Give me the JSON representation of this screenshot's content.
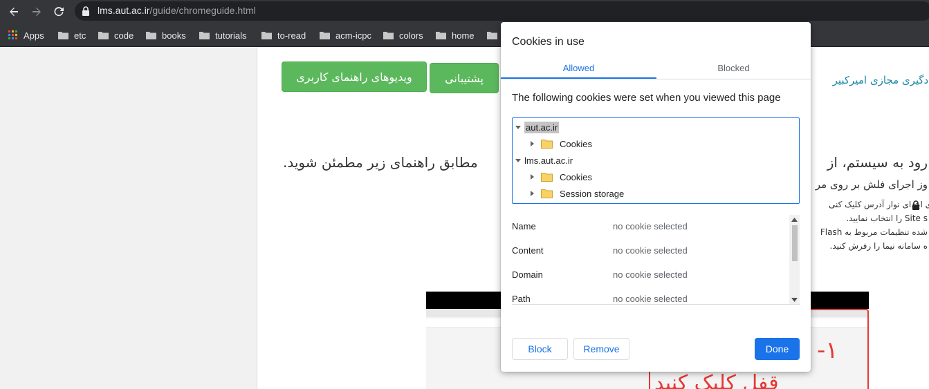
{
  "browser": {
    "url_host": "lms.aut.ac.ir",
    "url_path": "/guide/chromeguide.html",
    "bookmarks": [
      "Apps",
      "etc",
      "code",
      "books",
      "tutorials",
      "to-read",
      "acm-icpc",
      "colors",
      "home"
    ]
  },
  "page": {
    "button_videos": "ویدیوهای راهنمای کاربری",
    "button_support": "پشتیبانی",
    "site_title": "یادگیری مجازی امیرکبیر",
    "heading_right": "رود به سیستم، از",
    "heading_left": "مطابق راهنمای زیر مطمئن شوید.",
    "subheading": "وز اجرای فلش بر روی مر",
    "step1": "ی ابتدای نوار آدرس کلیک کنی",
    "step2": "Site s را انتخاب نمایید.",
    "step3": "شده تنظیمات مربوط به Flash",
    "step4": "ه سامانه نیما را رفرش کنید.",
    "video_overlay": "۱-",
    "video_overlay2": "قفل کلیک کنید"
  },
  "dialog": {
    "title": "Cookies in use",
    "tabs": {
      "allowed": "Allowed",
      "blocked": "Blocked",
      "active": "allowed"
    },
    "description": "The following cookies were set when you viewed this page",
    "tree": [
      {
        "label": "aut.ac.ir",
        "expanded": true,
        "selected": true,
        "children": [
          {
            "label": "Cookies"
          }
        ]
      },
      {
        "label": "lms.aut.ac.ir",
        "expanded": true,
        "children": [
          {
            "label": "Cookies"
          },
          {
            "label": "Session storage"
          }
        ]
      }
    ],
    "details": [
      {
        "label": "Name",
        "value": "no cookie selected"
      },
      {
        "label": "Content",
        "value": "no cookie selected"
      },
      {
        "label": "Domain",
        "value": "no cookie selected"
      },
      {
        "label": "Path",
        "value": "no cookie selected"
      }
    ],
    "buttons": {
      "block": "Block",
      "remove": "Remove",
      "done": "Done"
    }
  },
  "colors": {
    "accent": "#1a73e8",
    "green_button": "#5cb85c",
    "site_link": "#1a8aa8"
  }
}
